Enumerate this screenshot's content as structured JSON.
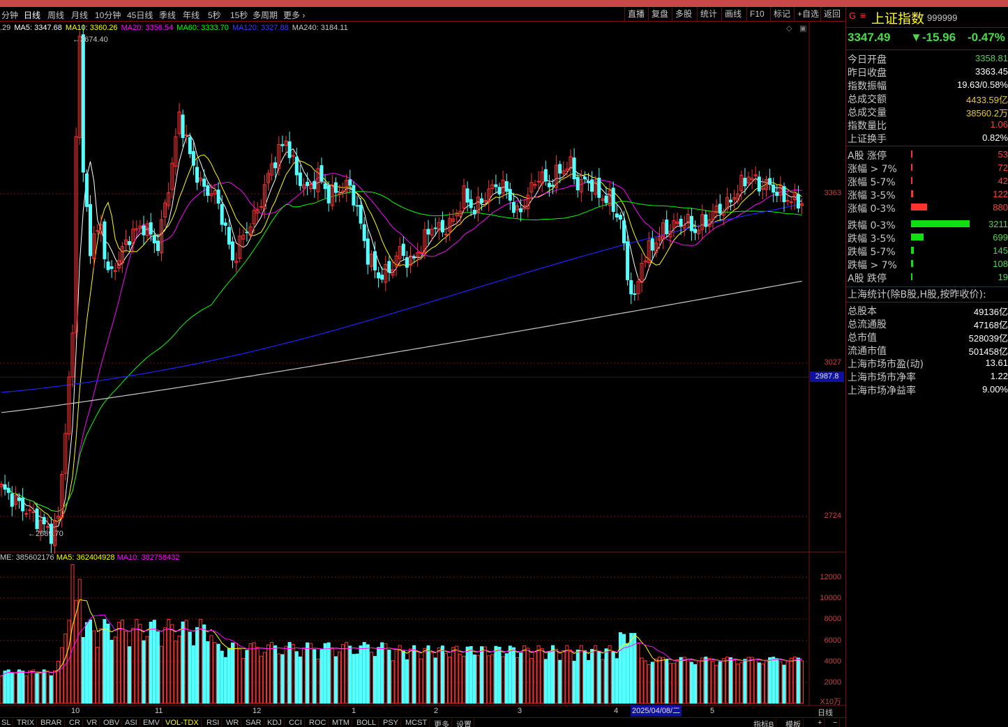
{
  "toolbar": {
    "periods": [
      "分钟",
      "日线",
      "周线",
      "月线",
      "10分钟",
      "45日线",
      "季线",
      "年线",
      "5秒",
      "15秒",
      "多周期",
      "更多"
    ],
    "right_buttons": [
      "直播",
      "复盘",
      "多股",
      "统计",
      "画线",
      "F10",
      "标记",
      "+自选",
      "返回"
    ]
  },
  "ma_legend": {
    "prefix": ".29",
    "ma5": "MA5: 3347.68",
    "ma10": "MA10: 3360.26",
    "ma20": "MA20: 3356.54",
    "ma60": "MA60: 3333.70",
    "ma120": "MA120: 3327.88",
    "ma240": "MA240: 3184.11"
  },
  "price_axis": {
    "labels": [
      "3363",
      "3027",
      "2724"
    ],
    "highlight": "2987.8"
  },
  "annotations": {
    "high": "3674.40",
    "low": "2689.70"
  },
  "volume_legend": {
    "volume": "ME: 385602176",
    "ma5": "MA5: 362404928",
    "ma10": "MA10: 382758432"
  },
  "volume_axis": {
    "labels": [
      "12000",
      "10000",
      "8000",
      "6000",
      "4000",
      "2000"
    ],
    "unit": "X10万"
  },
  "date_axis": {
    "labels": [
      "10",
      "11",
      "12",
      "1",
      "2",
      "3",
      "4",
      "5"
    ],
    "cursor_date": "2025/04/08/二"
  },
  "indicator_tabs": [
    "SL",
    "TRIX",
    "BRAR",
    "CR",
    "VR",
    "OBV",
    "ASI",
    "EMV",
    "VOL-TDX",
    "RSI",
    "WR",
    "SAR",
    "KDJ",
    "CCI",
    "ROC",
    "MTM",
    "BOLL",
    "PSY",
    "MCST",
    "更多",
    "设置"
  ],
  "bottom_right": {
    "period": "日线",
    "indicator_b": "指标B",
    "template": "模板",
    "plus": "+",
    "minus": "−"
  },
  "panel": {
    "logo": "G",
    "menu": "≡",
    "name": "上证指数",
    "code": "999999",
    "price": "3347.49",
    "change": "▼-15.96",
    "change_pct": "-0.47%",
    "stats": [
      {
        "label": "今日开盘",
        "value": "3358.81",
        "color": "#4bd84b"
      },
      {
        "label": "昨日收盘",
        "value": "3363.45",
        "color": "#ffffff"
      },
      {
        "label": "指数振幅",
        "value": "19.63/0.58%",
        "color": "#ffffff"
      },
      {
        "label": "总成交额",
        "value": "4433.59亿",
        "color": "#e8c83a"
      },
      {
        "label": "总成交量",
        "value": "38560.2万",
        "color": "#e8c83a"
      },
      {
        "label": "指数量比",
        "value": "1.06",
        "color": "#ff4040"
      },
      {
        "label": "上证换手",
        "value": "0.82%",
        "color": "#ffffff"
      }
    ],
    "breadth": [
      {
        "label": "A股 涨停",
        "value": "53",
        "up": true,
        "pct": 0.0
      },
      {
        "label": "涨幅 > 7%",
        "value": "72",
        "up": true,
        "pct": 0.0
      },
      {
        "label": "涨幅 5-7%",
        "value": "42",
        "up": true,
        "pct": 0.0
      },
      {
        "label": "涨幅 3-5%",
        "value": "122",
        "up": true,
        "pct": 0.04
      },
      {
        "label": "涨幅 0-3%",
        "value": "880",
        "up": true,
        "pct": 0.27
      },
      {
        "label": "跌幅 0-3%",
        "value": "3211",
        "up": false,
        "pct": 1.0
      },
      {
        "label": "跌幅 3-5%",
        "value": "699",
        "up": false,
        "pct": 0.22
      },
      {
        "label": "跌幅 5-7%",
        "value": "145",
        "up": false,
        "pct": 0.05
      },
      {
        "label": "跌幅 > 7%",
        "value": "108",
        "up": false,
        "pct": 0.03
      },
      {
        "label": "A股 跌停",
        "value": "19",
        "up": false,
        "pct": 0.0
      }
    ],
    "section_title": "上海统计(除B股,H股,按昨收价):",
    "market": [
      {
        "label": "总股本",
        "value": "49136亿"
      },
      {
        "label": "总流通股",
        "value": "47168亿"
      },
      {
        "label": "总市值",
        "value": "528039亿"
      },
      {
        "label": "流通市值",
        "value": "501458亿"
      },
      {
        "label": "上海市场市盈(动)",
        "value": "13.61"
      },
      {
        "label": "上海市场市净率",
        "value": "1.22"
      },
      {
        "label": "上海市场净益率",
        "value": "9.00%"
      }
    ]
  },
  "colors": {
    "up": "#ff3232",
    "down": "#54ffff",
    "ma5": "#ffffff",
    "ma10": "#ffff00",
    "ma20": "#ff00ff",
    "ma60": "#00ff00",
    "ma120": "#2020ff",
    "ma240": "#c8c8c8",
    "grid": "#7a1010"
  }
}
